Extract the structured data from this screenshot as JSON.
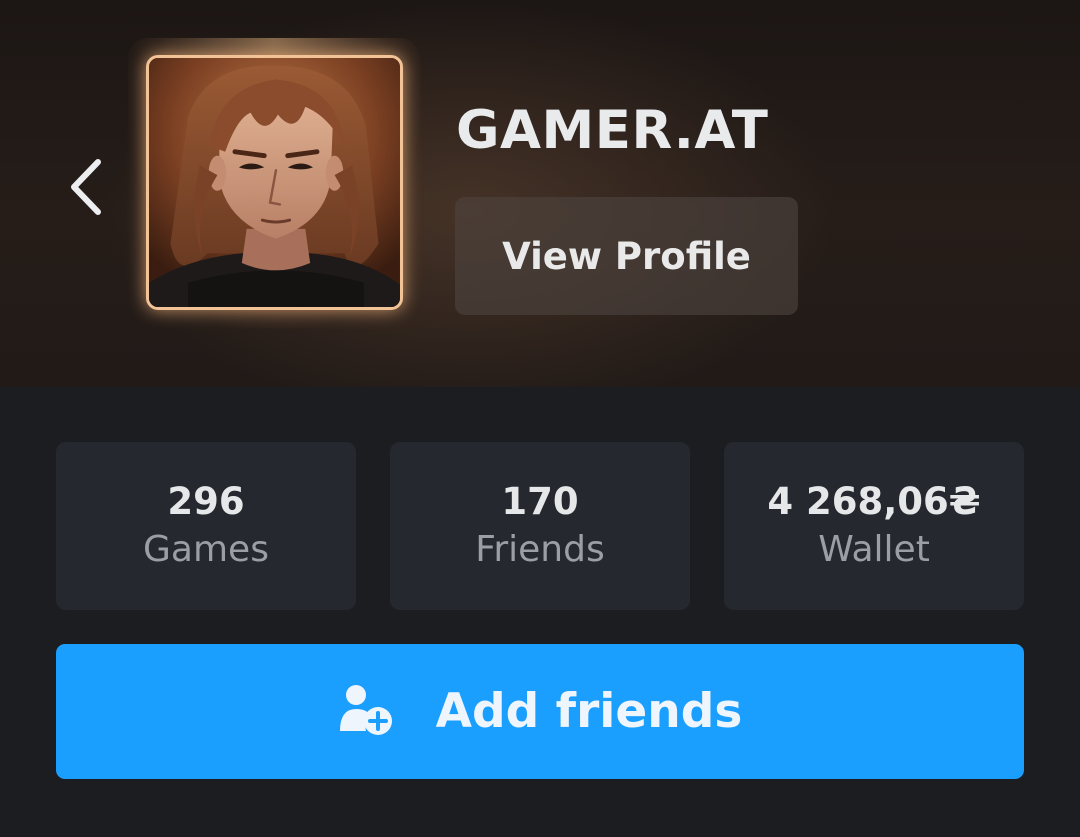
{
  "header": {
    "username": "GAMER.AT",
    "view_profile_label": "View Profile",
    "back_icon": "chevron-left-icon"
  },
  "stats": [
    {
      "value": "296",
      "label": "Games"
    },
    {
      "value": "170",
      "label": "Friends"
    },
    {
      "value": "4 268,06₴",
      "label": "Wallet"
    }
  ],
  "add_friends": {
    "label": "Add friends",
    "icon": "add-user-icon"
  },
  "colors": {
    "accent": "#1a9fff",
    "background": "#1b1d21",
    "card": "#25282e",
    "avatar_frame": "#f1c396"
  }
}
